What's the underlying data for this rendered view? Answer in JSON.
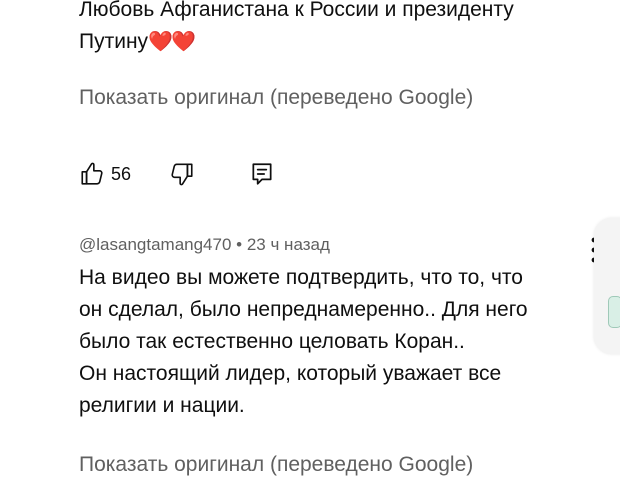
{
  "comment1": {
    "lines": [
      "Любовь Афганистана к России и президенту",
      "Путину"
    ],
    "emoji": "❤️❤️",
    "show_original": "Показать оригинал (переведено Google)",
    "like_count": "56"
  },
  "comment2": {
    "author": "@lasangtamang470",
    "separator": "•",
    "time": "23 ч назад",
    "lines": [
      "На видео вы можете подтвердить, что то, что",
      "он сделал, было непреднамеренно.. Для него",
      "было так естественно целовать Коран..",
      "Он настоящий лидер, который уважает все",
      "религии и нации."
    ],
    "show_original": "Показать оригинал (переведено Google)"
  },
  "icons": {
    "like": "thumbs-up-icon",
    "dislike": "thumbs-down-icon",
    "reply": "reply-comment-icon",
    "menu": "more-vertical-icon"
  },
  "colors": {
    "text": "#0f0f0f",
    "secondary": "#606060",
    "heart": "#e0202e"
  }
}
